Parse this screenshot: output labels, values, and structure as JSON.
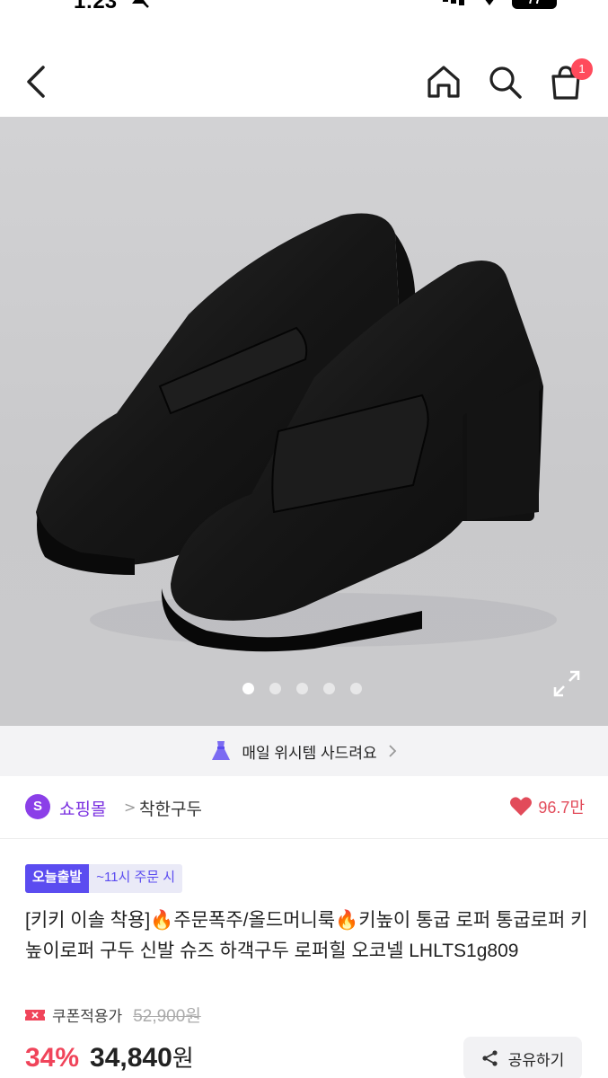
{
  "status_bar": {
    "time": "1:23",
    "battery": "77"
  },
  "nav": {
    "cart_count": "1"
  },
  "gallery": {
    "total_images": 5,
    "active_index": 0
  },
  "banner": {
    "text": "매일 위시템 사드려요"
  },
  "store": {
    "logo_letter": "S",
    "name": "쇼핑몰",
    "separator": ">",
    "sub_name": "착한구두",
    "likes": "96.7만"
  },
  "product": {
    "badge_today": "오늘출발",
    "badge_time": "~11시 주문 시",
    "title": "[키키 이솔 착용]🔥주문폭주/올드머니룩🔥키높이 통굽 로퍼 통굽로퍼 키높이로퍼 구두 신발 슈즈 하객구두 로퍼힐 오코넬 LHLTS1g809",
    "coupon_label": "쿠폰적용가",
    "original_price": "52,900원",
    "discount": "34%",
    "price": "34,840",
    "price_unit": "원",
    "share_label": "공유하기"
  },
  "colors": {
    "accent_purple": "#7a2fe0",
    "badge_blue": "#5b4cf0",
    "discount_red": "#f0445a",
    "heart_red": "#e24b5a"
  }
}
